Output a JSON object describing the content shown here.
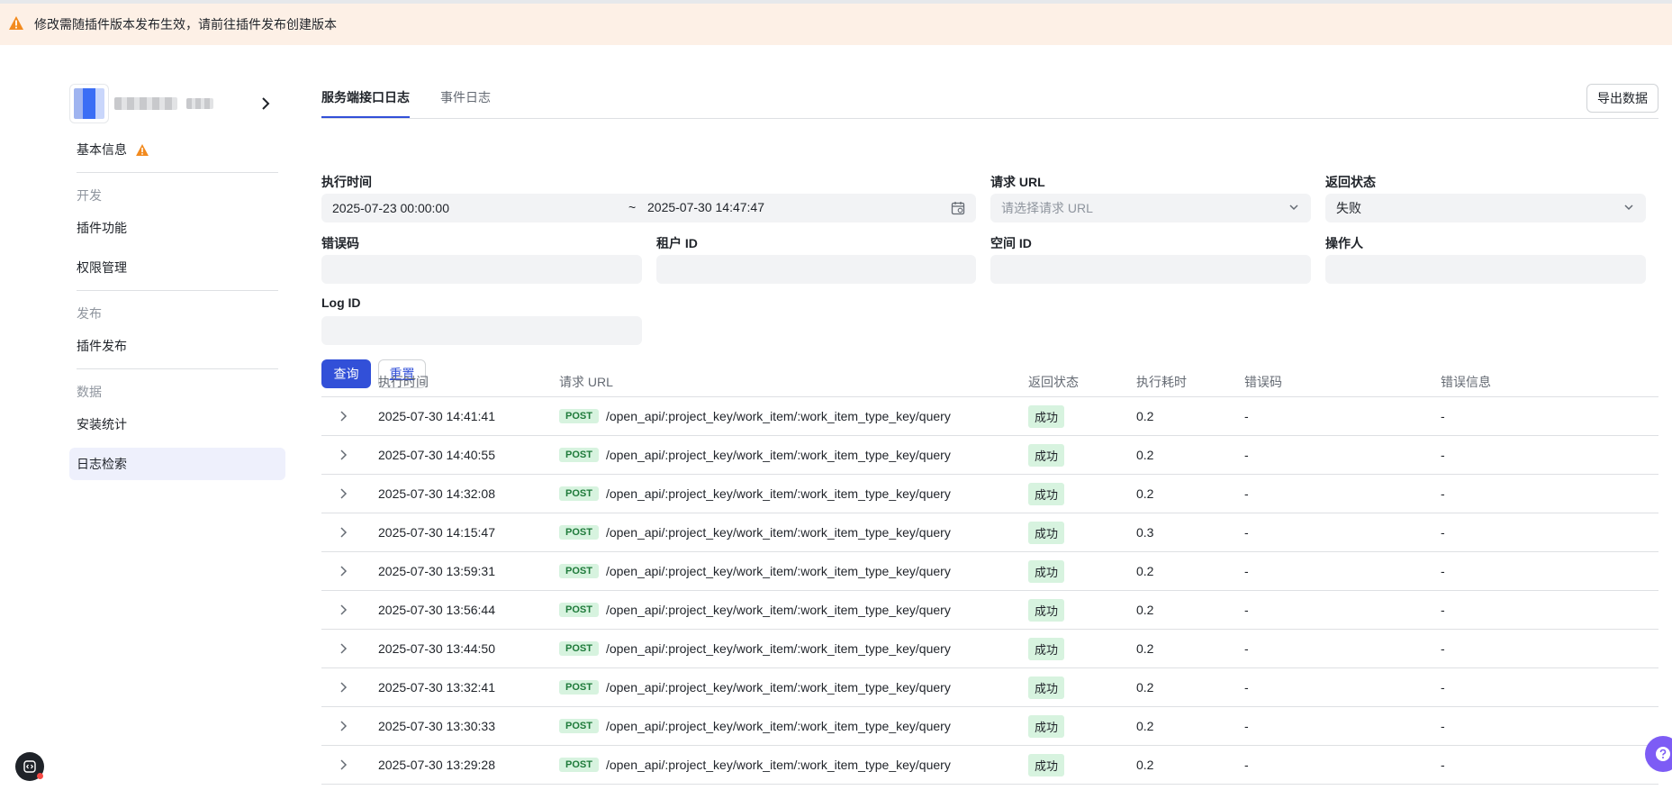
{
  "banner": {
    "text": "修改需随插件版本发布生效，请前往插件发布创建版本"
  },
  "sidebar": {
    "items": {
      "basic_info": "基本信息",
      "group_dev": "开发",
      "plugin_function": "插件功能",
      "permission": "权限管理",
      "group_publish": "发布",
      "plugin_publish": "插件发布",
      "group_data": "数据",
      "install_stats": "安装统计",
      "log_search": "日志检索"
    }
  },
  "tabs": {
    "server_log": "服务端接口日志",
    "event_log": "事件日志"
  },
  "toolbar": {
    "export_label": "导出数据"
  },
  "filters": {
    "exec_time_label": "执行时间",
    "start_time": "2025-07-23 00:00:00",
    "range_sep": "~",
    "end_time": "2025-07-30 14:47:47",
    "request_url_label": "请求 URL",
    "request_url_placeholder": "请选择请求 URL",
    "return_status_label": "返回状态",
    "return_status_value": "失败",
    "error_code_label": "错误码",
    "tenant_id_label": "租户 ID",
    "space_id_label": "空间 ID",
    "operator_label": "操作人",
    "log_id_label": "Log ID",
    "query_label": "查询",
    "reset_label": "重置"
  },
  "table": {
    "headers": {
      "exec_time": "执行时间",
      "request_url": "请求 URL",
      "status": "返回状态",
      "duration": "执行耗时",
      "error_code": "错误码",
      "error_msg": "错误信息"
    },
    "rows": [
      {
        "time": "2025-07-30 14:41:41",
        "method": "POST",
        "url": "/open_api/:project_key/work_item/:work_item_type_key/query",
        "status": "成功",
        "duration": "0.2",
        "code": "-",
        "msg": "-"
      },
      {
        "time": "2025-07-30 14:40:55",
        "method": "POST",
        "url": "/open_api/:project_key/work_item/:work_item_type_key/query",
        "status": "成功",
        "duration": "0.2",
        "code": "-",
        "msg": "-"
      },
      {
        "time": "2025-07-30 14:32:08",
        "method": "POST",
        "url": "/open_api/:project_key/work_item/:work_item_type_key/query",
        "status": "成功",
        "duration": "0.2",
        "code": "-",
        "msg": "-"
      },
      {
        "time": "2025-07-30 14:15:47",
        "method": "POST",
        "url": "/open_api/:project_key/work_item/:work_item_type_key/query",
        "status": "成功",
        "duration": "0.3",
        "code": "-",
        "msg": "-"
      },
      {
        "time": "2025-07-30 13:59:31",
        "method": "POST",
        "url": "/open_api/:project_key/work_item/:work_item_type_key/query",
        "status": "成功",
        "duration": "0.2",
        "code": "-",
        "msg": "-"
      },
      {
        "time": "2025-07-30 13:56:44",
        "method": "POST",
        "url": "/open_api/:project_key/work_item/:work_item_type_key/query",
        "status": "成功",
        "duration": "0.2",
        "code": "-",
        "msg": "-"
      },
      {
        "time": "2025-07-30 13:44:50",
        "method": "POST",
        "url": "/open_api/:project_key/work_item/:work_item_type_key/query",
        "status": "成功",
        "duration": "0.2",
        "code": "-",
        "msg": "-"
      },
      {
        "time": "2025-07-30 13:32:41",
        "method": "POST",
        "url": "/open_api/:project_key/work_item/:work_item_type_key/query",
        "status": "成功",
        "duration": "0.2",
        "code": "-",
        "msg": "-"
      },
      {
        "time": "2025-07-30 13:30:33",
        "method": "POST",
        "url": "/open_api/:project_key/work_item/:work_item_type_key/query",
        "status": "成功",
        "duration": "0.2",
        "code": "-",
        "msg": "-"
      },
      {
        "time": "2025-07-30 13:29:28",
        "method": "POST",
        "url": "/open_api/:project_key/work_item/:work_item_type_key/query",
        "status": "成功",
        "duration": "0.2",
        "code": "-",
        "msg": "-"
      }
    ]
  },
  "icons": {
    "banner": "warning-icon",
    "basic_info": "warning-icon",
    "header": "chevron-right-icon",
    "calendar": "calendar-icon",
    "select": "chevron-down-icon",
    "row_expand": "chevron-right-icon",
    "help": "help-icon",
    "dev": "code-icon"
  },
  "colors": {
    "accent": "#3250d8",
    "warning": "#f28a1e",
    "success_bg": "#d7f3df",
    "banner_bg": "#fdf0e6",
    "help_bg": "#7d5cf5"
  }
}
